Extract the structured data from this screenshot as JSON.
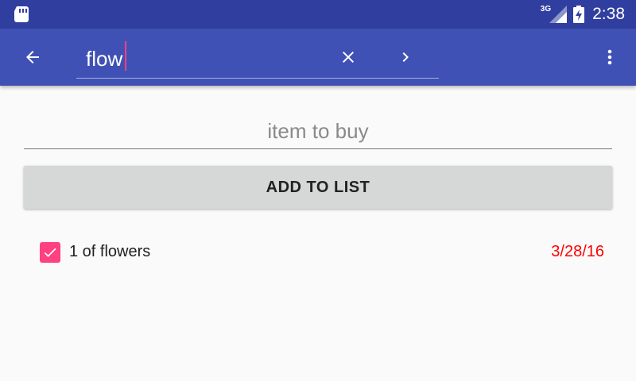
{
  "status_bar": {
    "network_label": "3G",
    "time": "2:38",
    "icons": [
      "sd-card-icon",
      "signal-icon",
      "battery-charging-icon"
    ]
  },
  "toolbar": {
    "search_value": "flow",
    "icons": [
      "back-arrow-icon",
      "close-icon",
      "chevron-right-icon",
      "more-vert-icon"
    ]
  },
  "form": {
    "item_placeholder": "item to buy",
    "add_button_label": "ADD TO LIST"
  },
  "list": {
    "items": [
      {
        "label": "1 of flowers",
        "date": "3/28/16",
        "checked": true
      }
    ]
  },
  "colors": {
    "status_bar": "#303f9f",
    "toolbar": "#3f51b5",
    "accent": "#ff4081",
    "date_text": "#ff0000"
  }
}
